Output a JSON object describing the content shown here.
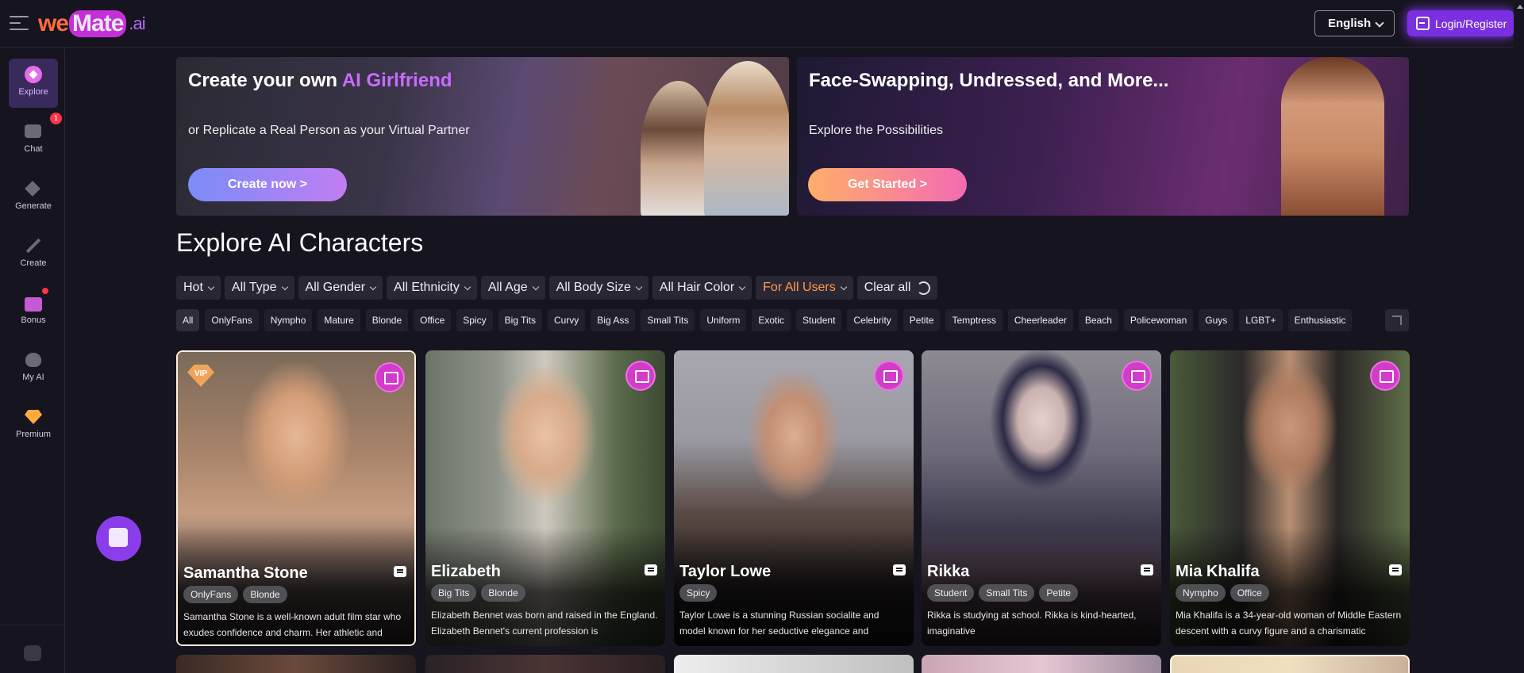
{
  "brand": {
    "logo_part1": "we",
    "logo_part2": "Mate",
    "logo_part3": ".ai"
  },
  "header": {
    "language": "English",
    "login_label": "Login/Register"
  },
  "sidebar": {
    "items": [
      {
        "label": "Explore",
        "icon": "compass-icon"
      },
      {
        "label": "Chat",
        "icon": "chat-icon",
        "badge": "1"
      },
      {
        "label": "Generate",
        "icon": "sparkle-icon"
      },
      {
        "label": "Create",
        "icon": "magic-wand-icon"
      },
      {
        "label": "Bonus",
        "icon": "gift-icon"
      },
      {
        "label": "My AI",
        "icon": "heart-icon"
      },
      {
        "label": "Premium",
        "icon": "diamond-icon"
      }
    ]
  },
  "banners": [
    {
      "title_plain": "Create your own ",
      "title_highlight": "AI Girlfriend",
      "subtitle": "or Replicate a Real Person as your Virtual Partner",
      "button": "Create now >"
    },
    {
      "title_plain": "Face-Swapping, Undressed, and More...",
      "title_highlight": "",
      "subtitle": "Explore the Possibilities",
      "button": "Get Started >"
    }
  ],
  "explore": {
    "title": "Explore AI Characters",
    "filters": [
      "Hot",
      "All Type",
      "All Gender",
      "All Ethnicity",
      "All Age",
      "All Body Size",
      "All Hair Color",
      "For All Users"
    ],
    "clear_label": "Clear all",
    "tags": [
      "All",
      "OnlyFans",
      "Nympho",
      "Mature",
      "Blonde",
      "Office",
      "Spicy",
      "Big Tits",
      "Curvy",
      "Big Ass",
      "Small Tits",
      "Uniform",
      "Exotic",
      "Student",
      "Celebrity",
      "Petite",
      "Temptress",
      "Cheerleader",
      "Beach",
      "Policewoman",
      "Guys",
      "LGBT+",
      "Enthusiastic"
    ]
  },
  "cards": [
    {
      "name": "Samantha Stone",
      "tags": [
        "OnlyFans",
        "Blonde"
      ],
      "desc": "Samantha Stone is a well-known adult film star who exudes confidence and charm. Her athletic and toned",
      "vip": "VIP"
    },
    {
      "name": "Elizabeth",
      "tags": [
        "Big Tits",
        "Blonde"
      ],
      "desc": "Elizabeth Bennet was born and raised in the England. Elizabeth Bennet's current profession is",
      "vip": ""
    },
    {
      "name": "Taylor Lowe",
      "tags": [
        "Spicy"
      ],
      "desc": "Taylor Lowe is a stunning Russian socialite and model known for her seductive elegance and",
      "vip": ""
    },
    {
      "name": "Rikka",
      "tags": [
        "Student",
        "Small Tits",
        "Petite"
      ],
      "desc": "Rikka is studying at school. Rikka is kind-hearted, imaginative",
      "vip": ""
    },
    {
      "name": "Mia Khalifa",
      "tags": [
        "Nympho",
        "Office"
      ],
      "desc": "Mia Khalifa is a 34-year-old woman of Middle Eastern descent with a curvy figure and a charismatic",
      "vip": ""
    }
  ],
  "colors": {
    "accent": "#7a2fe0",
    "orange": "#ff9a4c",
    "bg": "#16141f"
  }
}
